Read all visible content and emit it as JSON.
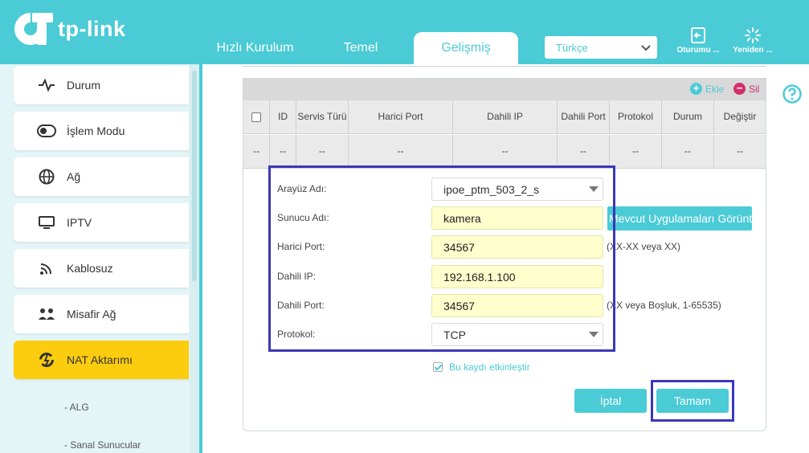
{
  "header": {
    "logo_text": "tp-link",
    "tabs": [
      {
        "label": "Hızlı Kurulum"
      },
      {
        "label": "Temel"
      },
      {
        "label": "Gelişmiş"
      }
    ],
    "language": "Türkçe",
    "logout_label": "Oturumu ...",
    "reboot_label": "Yeniden ..."
  },
  "sidebar": {
    "items": [
      {
        "label": "Durum",
        "icon": "pulse-icon"
      },
      {
        "label": "İşlem Modu",
        "icon": "toggle-icon"
      },
      {
        "label": "Ağ",
        "icon": "globe-icon"
      },
      {
        "label": "IPTV",
        "icon": "monitor-icon"
      },
      {
        "label": "Kablosuz",
        "icon": "wifi-icon"
      },
      {
        "label": "Misafir Ağ",
        "icon": "guests-icon"
      },
      {
        "label": "NAT Aktarımı",
        "icon": "nat-icon"
      }
    ],
    "sub_items": [
      {
        "label": "- ALG"
      },
      {
        "label": "- Sanal Sunucular"
      }
    ]
  },
  "table": {
    "add_label": "Ekle",
    "delete_label": "Sil",
    "columns": [
      "ID",
      "Servis Türü",
      "Harici Port",
      "Dahili IP",
      "Dahili Port",
      "Protokol",
      "Durum",
      "Değiştir"
    ],
    "row": [
      "--",
      "--",
      "--",
      "--",
      "--",
      "--",
      "--",
      "--",
      "--"
    ]
  },
  "form": {
    "interface_label": "Arayüz Adı:",
    "interface_value": "ipoe_ptm_503_2_s",
    "server_label": "Sunucu Adı:",
    "server_value": "kamera",
    "apps_button": "Mevcut Uygulamaları Görüntüle",
    "external_port_label": "Harici Port:",
    "external_port_value": "34567",
    "external_port_hint": "(XX-XX veya XX)",
    "internal_ip_label": "Dahili IP:",
    "internal_ip_value": "192.168.1.100",
    "internal_port_label": "Dahili Port:",
    "internal_port_value": "34567",
    "internal_port_hint": "(XX veya Boşluk, 1-65535)",
    "protocol_label": "Protokol:",
    "protocol_value": "TCP",
    "enable_label": "Bu kaydı etkinleştir",
    "cancel_label": "İptal",
    "ok_label": "Tamam"
  },
  "colors": {
    "brand": "#4acbd6",
    "active_nav": "#fccc0f",
    "highlight": "#3a39b8",
    "input_bg": "#fffecd"
  }
}
